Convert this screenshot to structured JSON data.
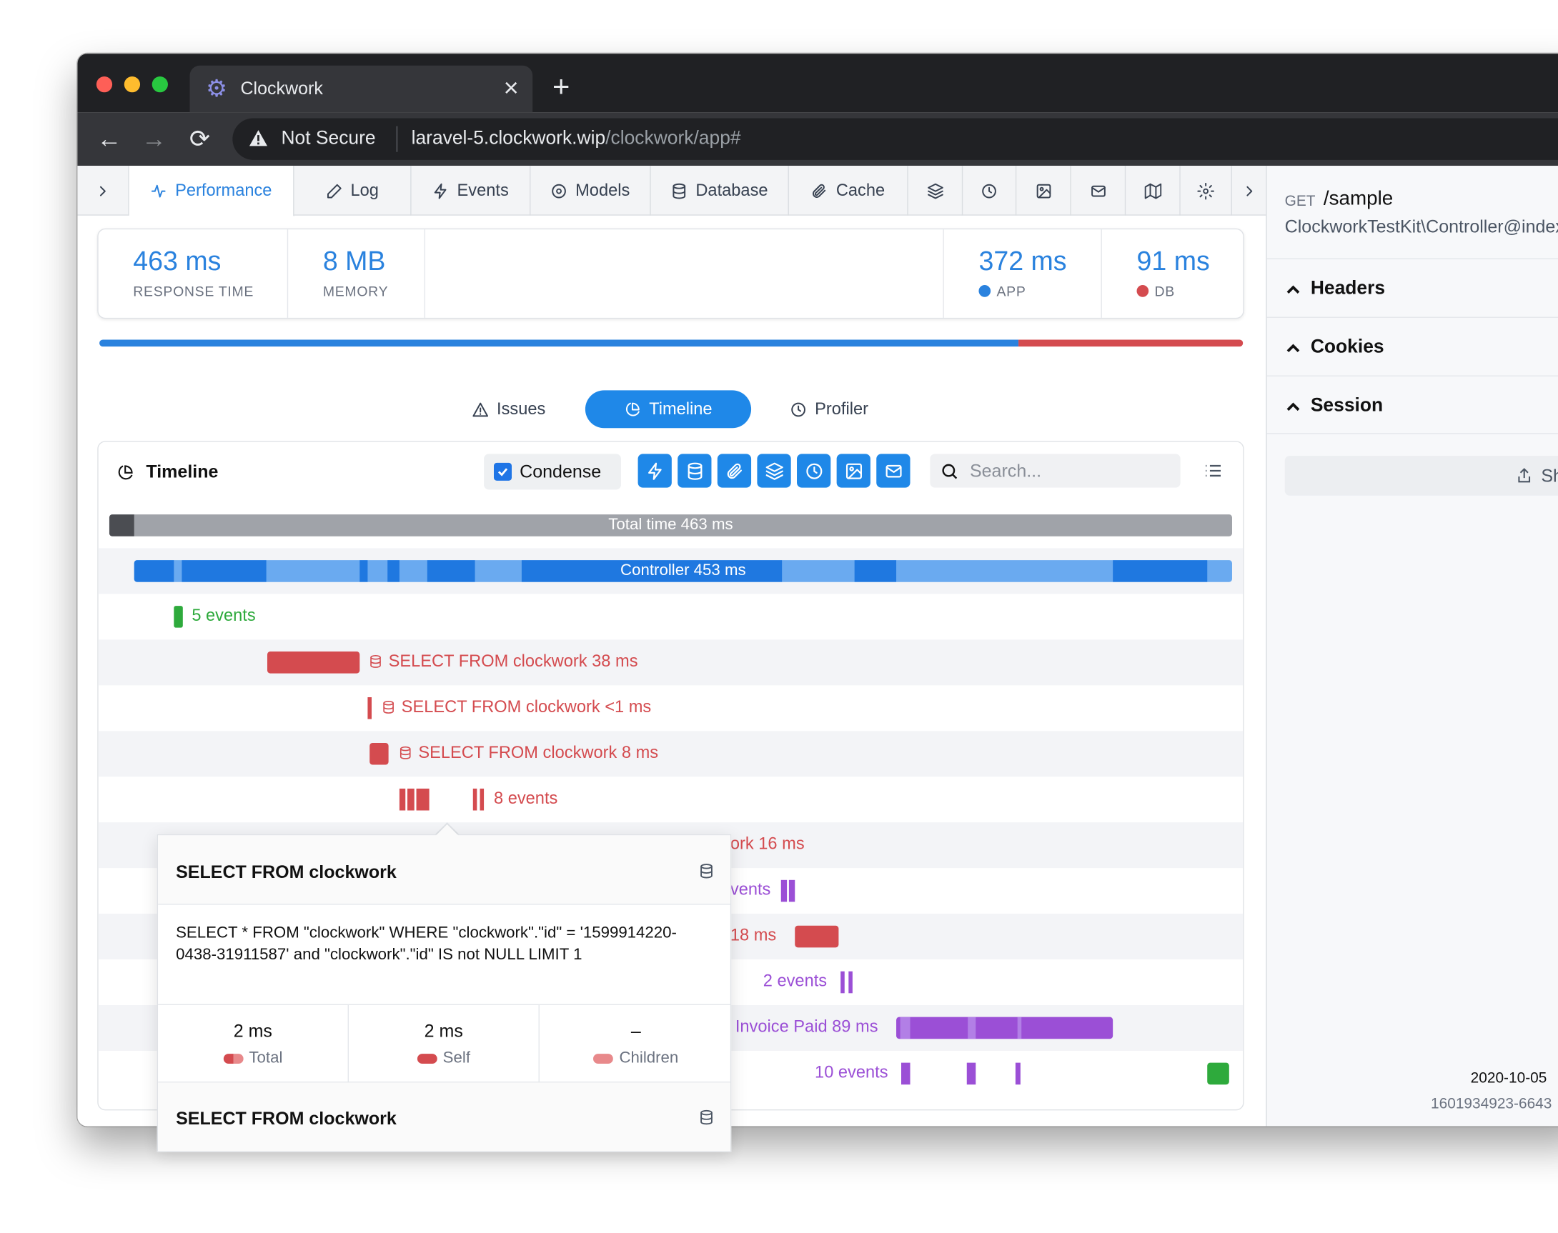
{
  "browser": {
    "tab_title": "Clockwork",
    "new_tab": "+",
    "security_label": "Not Secure",
    "url_host": "laravel-5.clockwork.wip",
    "url_path": "/clockwork/app#"
  },
  "tabs": [
    {
      "label": "Performance",
      "icon": "activity-icon"
    },
    {
      "label": "Log",
      "icon": "pencil-icon"
    },
    {
      "label": "Events",
      "icon": "zap-icon"
    },
    {
      "label": "Models",
      "icon": "disc-icon"
    },
    {
      "label": "Database",
      "icon": "database-icon"
    },
    {
      "label": "Cache",
      "icon": "paperclip-icon"
    }
  ],
  "stats": {
    "response_time": {
      "value": "463 ms",
      "label": "RESPONSE TIME"
    },
    "memory": {
      "value": "8 MB",
      "label": "MEMORY"
    },
    "app": {
      "value": "372 ms",
      "label": "APP",
      "color": "#2a82de"
    },
    "db": {
      "value": "91 ms",
      "label": "DB",
      "color": "#d44b4f"
    }
  },
  "progress": {
    "app_fraction": 0.8035,
    "db_fraction": 0.1965
  },
  "subtabs": {
    "issues": "Issues",
    "timeline": "Timeline",
    "profiler": "Profiler"
  },
  "timeline": {
    "title": "Timeline",
    "condense_label": "Condense",
    "condense_checked": true,
    "search_placeholder": "Search...",
    "total_label": "Total time 463 ms",
    "controller_label": "Controller 453 ms",
    "rows": [
      {
        "label": "5 events",
        "color": "#2eaa3c"
      },
      {
        "label": "SELECT FROM clockwork 38 ms",
        "color": "#d44b4f"
      },
      {
        "label": "SELECT FROM clockwork <1 ms",
        "color": "#d44b4f"
      },
      {
        "label": "SELECT FROM clockwork 8 ms",
        "color": "#d44b4f"
      },
      {
        "label": "8 events",
        "color": "#d44b4f"
      },
      {
        "label": "ork 16 ms",
        "color": "#d44b4f"
      },
      {
        "label": "vents",
        "color": "#9b4fd6"
      },
      {
        "label": "18 ms",
        "color": "#d44b4f"
      },
      {
        "label": "2 events",
        "color": "#9b4fd6"
      },
      {
        "label": "Invoice Paid 89 ms",
        "color": "#9b4fd6"
      },
      {
        "label": "10 events",
        "color": "#9b4fd6"
      }
    ]
  },
  "popover": {
    "title": "SELECT FROM clockwork",
    "query": "SELECT * FROM \"clockwork\" WHERE \"clockwork\".\"id\" = '1599914220-0438-31911587' and \"clockwork\".\"id\" IS not NULL LIMIT 1",
    "total": {
      "value": "2 ms",
      "label": "Total"
    },
    "self": {
      "value": "2 ms",
      "label": "Self"
    },
    "children": {
      "value": "–",
      "label": "Children"
    },
    "next_title": "SELECT FROM clockwork"
  },
  "sidebar": {
    "method": "GET",
    "path": "/sample",
    "controller": "ClockworkTestKit\\Controller@index",
    "sections": [
      "Headers",
      "Cookies",
      "Session"
    ],
    "share_label": "Share",
    "date": "2020-10-05",
    "request_id": "1601934923-6643"
  }
}
